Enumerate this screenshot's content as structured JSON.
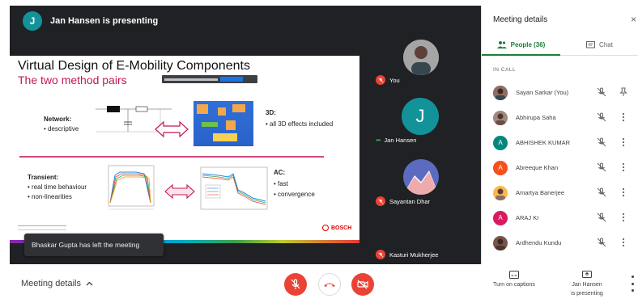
{
  "presenter_banner": {
    "avatar_letter": "J",
    "text": "Jan Hansen is presenting"
  },
  "slide": {
    "title": "Virtual Design of E-Mobility Components",
    "subtitle": "The two method pairs",
    "network_label": "Network:",
    "network_desc": "• descriptive",
    "threeD_label": "3D:",
    "threeD_desc": "• all 3D effects included",
    "transient_label": "Transient:",
    "transient_desc1": "• real time behaviour",
    "transient_desc2": "• non-linearities",
    "ac_label": "AC:",
    "ac_desc1": "• fast",
    "ac_desc2": "• convergence",
    "brand": "BOSCH"
  },
  "toast": {
    "text": "Bhaskar Gupta has left the meeting"
  },
  "tiles": [
    {
      "name": "You"
    },
    {
      "name": "Jan Hansen",
      "avatar_letter": "J"
    },
    {
      "name": "Sayantan Dhar"
    },
    {
      "name": "Kasturi Mukherjee"
    }
  ],
  "panel": {
    "title": "Meeting details",
    "close_glyph": "×",
    "tab_people": "People (36)",
    "tab_chat": "Chat",
    "in_call_label": "IN CALL",
    "people": [
      {
        "name": "Sayan Sarkar (You)",
        "avatar_type": "photo",
        "color": "#5d4037"
      },
      {
        "name": "Abhirupa Saha",
        "avatar_type": "photo",
        "color": "#6d4c41"
      },
      {
        "name": "ABHISHEK KUMAR",
        "avatar_type": "letter",
        "letter": "A",
        "color": "#00897b"
      },
      {
        "name": "Abreeque Khan",
        "avatar_type": "letter",
        "letter": "A",
        "color": "#f4511e"
      },
      {
        "name": "Amartya Banerjee",
        "avatar_type": "photo",
        "color": "#8d6e63"
      },
      {
        "name": "ARAJ Kr",
        "avatar_type": "letter",
        "letter": "A",
        "color": "#d81b60"
      },
      {
        "name": "Ardhendu Kundu",
        "avatar_type": "photo",
        "color": "#4e342e"
      }
    ]
  },
  "bottom_bar": {
    "meeting_details": "Meeting details",
    "captions_label": "Turn on captions",
    "present_label_1": "Jan Hansen",
    "present_label_2": "is presenting"
  },
  "colors": {
    "accent_green": "#188038",
    "danger_red": "#ea4335",
    "stage_bg": "#202124",
    "slide_pink": "#c2185b"
  }
}
